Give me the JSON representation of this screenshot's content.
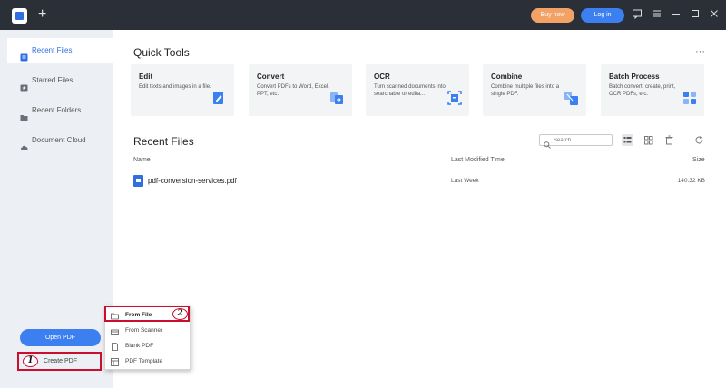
{
  "titlebar": {
    "new_tab_symbol": "+",
    "buy_now_label": "Buy now",
    "login_label": "Log in",
    "colors": {
      "background": "#2a2f38",
      "buy_now": "#f2a264",
      "login": "#3b7ff0"
    }
  },
  "sidebar": {
    "items": [
      {
        "label": "Recent Files",
        "icon": "recent-files-icon",
        "active": true
      },
      {
        "label": "Starred Files",
        "icon": "star-folder-icon",
        "active": false
      },
      {
        "label": "Recent Folders",
        "icon": "folder-icon",
        "active": false
      },
      {
        "label": "Document Cloud",
        "icon": "cloud-icon",
        "active": false
      }
    ],
    "open_pdf_label": "Open PDF",
    "create_pdf_label": "Create PDF",
    "create_marker": "1"
  },
  "quick_tools": {
    "title": "Quick Tools",
    "more_label": "···",
    "cards": [
      {
        "title": "Edit",
        "desc": "Edit texts and images in a file.",
        "icon": "edit-tool-icon"
      },
      {
        "title": "Convert",
        "desc": "Convert PDFs to Word, Excel, PPT, etc.",
        "icon": "convert-tool-icon"
      },
      {
        "title": "OCR",
        "desc": "Turn scanned documents into searchable or edita...",
        "icon": "ocr-tool-icon"
      },
      {
        "title": "Combine",
        "desc": "Combine multiple files into a single PDF.",
        "icon": "combine-tool-icon"
      },
      {
        "title": "Batch Process",
        "desc": "Batch convert, create, print, OCR PDFs, etc.",
        "icon": "batch-process-icon"
      }
    ]
  },
  "recent_files": {
    "title": "Recent Files",
    "search_placeholder": "Search",
    "columns": {
      "name": "Name",
      "modified": "Last Modified Time",
      "size": "Size"
    },
    "rows": [
      {
        "name": "pdf-conversion-services.pdf",
        "modified": "Last Week",
        "size": "140.32 KB"
      }
    ]
  },
  "create_menu": {
    "items": [
      {
        "label": "From File",
        "icon": "folder-icon"
      },
      {
        "label": "From Scanner",
        "icon": "scanner-icon"
      },
      {
        "label": "Blank PDF",
        "icon": "blank-page-icon"
      },
      {
        "label": "PDF Template",
        "icon": "template-icon"
      }
    ],
    "from_file_marker": "2"
  },
  "colors": {
    "accent": "#2f6fe0",
    "highlight": "#c8102e"
  }
}
